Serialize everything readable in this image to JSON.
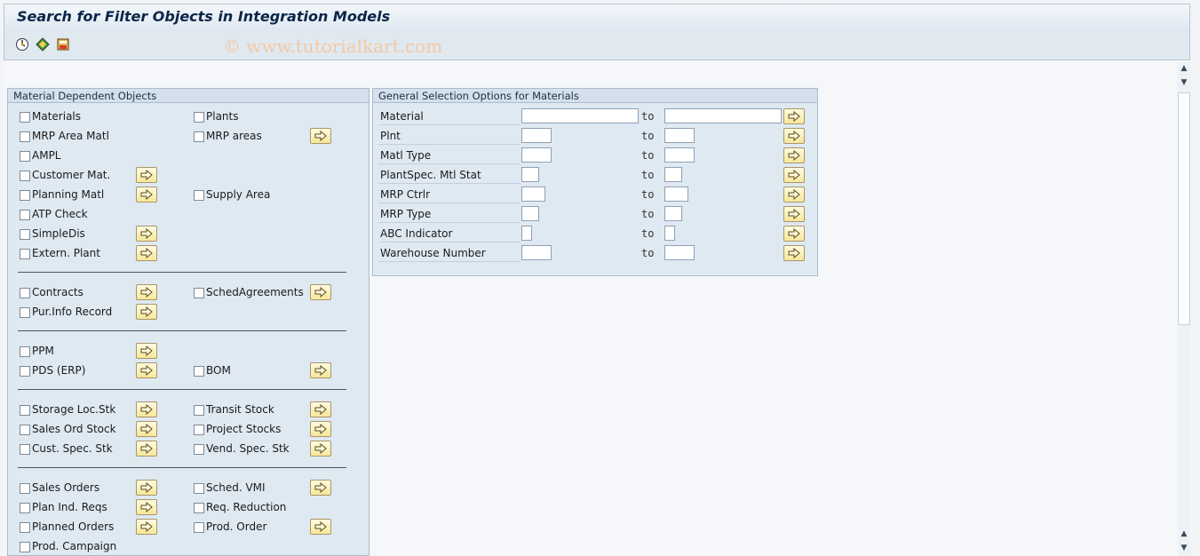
{
  "window": {
    "title": "Search for Filter Objects in Integration Models",
    "watermark": "© www.tutorialkart.com"
  },
  "left_group": {
    "title": "Material Dependent Objects",
    "items": [
      {
        "label": "Materials"
      },
      {
        "label": "Plants"
      },
      {
        "label": "MRP Area Matl"
      },
      {
        "label": "MRP areas"
      },
      {
        "label": "AMPL"
      },
      {
        "label": "Customer Mat."
      },
      {
        "label": "Planning Matl"
      },
      {
        "label": "Supply Area"
      },
      {
        "label": "ATP Check"
      },
      {
        "label": "SimpleDis"
      },
      {
        "label": "Extern. Plant"
      },
      {
        "label": "Contracts"
      },
      {
        "label": "SchedAgreements"
      },
      {
        "label": "Pur.Info Record"
      },
      {
        "label": "PPM"
      },
      {
        "label": "PDS (ERP)"
      },
      {
        "label": "BOM"
      },
      {
        "label": "Storage Loc.Stk"
      },
      {
        "label": "Transit Stock"
      },
      {
        "label": "Sales Ord Stock"
      },
      {
        "label": "Project Stocks"
      },
      {
        "label": "Cust. Spec. Stk"
      },
      {
        "label": "Vend. Spec. Stk"
      },
      {
        "label": "Sales Orders"
      },
      {
        "label": "Sched. VMI"
      },
      {
        "label": "Plan Ind. Reqs"
      },
      {
        "label": "Req. Reduction"
      },
      {
        "label": "Planned Orders"
      },
      {
        "label": "Prod. Order"
      },
      {
        "label": "Prod. Campaign"
      }
    ]
  },
  "right_group": {
    "title": "General Selection Options for Materials",
    "to_label": "to",
    "rows": [
      {
        "label": "Material",
        "from": "",
        "to": ""
      },
      {
        "label": "Plnt",
        "from": "",
        "to": ""
      },
      {
        "label": "Matl Type",
        "from": "",
        "to": ""
      },
      {
        "label": "PlantSpec. Mtl Stat",
        "from": "",
        "to": ""
      },
      {
        "label": "MRP Ctrlr",
        "from": "",
        "to": ""
      },
      {
        "label": "MRP Type",
        "from": "",
        "to": ""
      },
      {
        "label": "ABC Indicator",
        "from": "",
        "to": ""
      },
      {
        "label": "Warehouse Number",
        "from": "",
        "to": ""
      }
    ]
  },
  "colors": {
    "accent_button": "#f7e79a",
    "group_bg": "#dfe9f2",
    "title_text": "#0c2547"
  },
  "icons": [
    "execute-icon",
    "variant-icon",
    "save-variant-icon",
    "multiple-selection-icon"
  ]
}
